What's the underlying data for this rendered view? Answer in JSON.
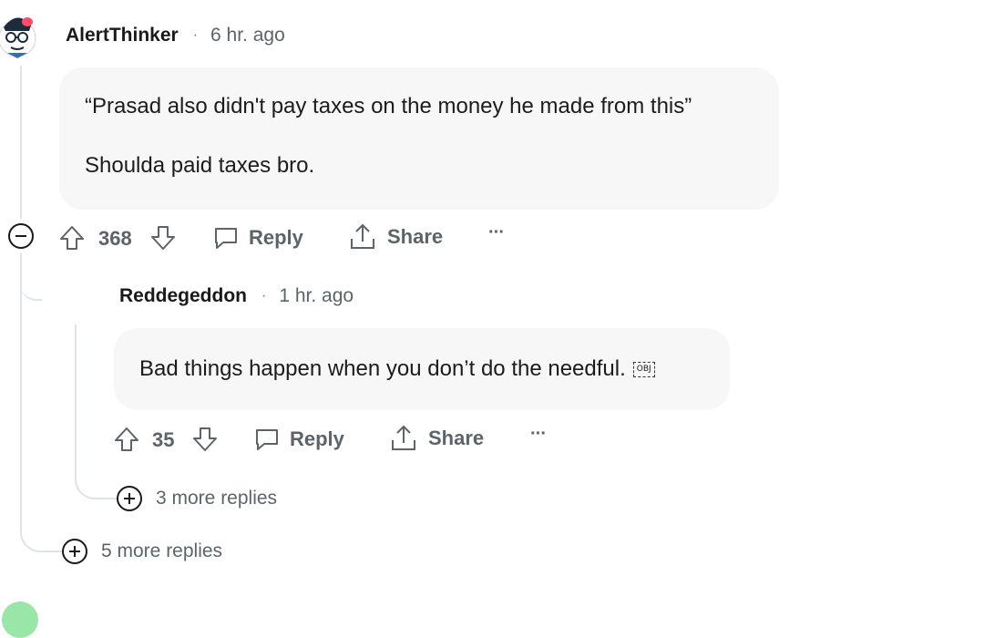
{
  "comment1": {
    "username": "AlertThinker",
    "separator": "·",
    "time": "6 hr. ago",
    "paragraphs": [
      "“Prasad also didn't pay taxes on the money he made from this”",
      "Shoulda paid taxes bro."
    ],
    "votes": "368",
    "reply_label": "Reply",
    "share_label": "Share",
    "more_label": "···",
    "more_replies": "5 more replies"
  },
  "comment2": {
    "username": "Reddegeddon",
    "separator": "·",
    "time": "1 hr. ago",
    "text": "Bad things happen when you don’t do the needful.",
    "obj_glyph": "OBJ",
    "votes": "35",
    "reply_label": "Reply",
    "share_label": "Share",
    "more_label": "···",
    "more_replies": "3 more replies"
  },
  "icons": {
    "upvote": "upvote-icon",
    "downvote": "downvote-icon",
    "reply": "comment-icon",
    "share": "share-icon",
    "collapse": "collapse-icon",
    "expand": "expand-icon"
  },
  "colors": {
    "text": "#1a1a1b",
    "muted": "#5c6469",
    "bubble": "#f7f7f8",
    "thread_line": "#dfe3e6",
    "avatar_accent": "#46d160"
  }
}
